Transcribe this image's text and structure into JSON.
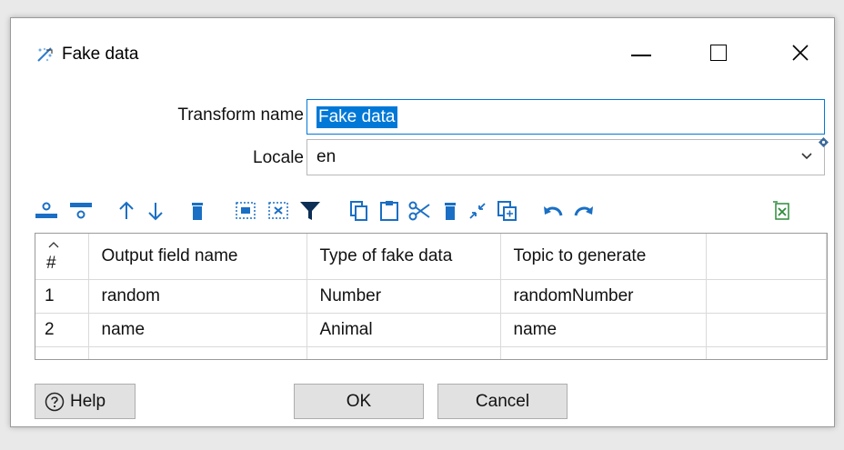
{
  "window": {
    "title": "Fake data",
    "icon": "fake-data-icon",
    "controls": [
      "minimize-icon",
      "maximize-icon",
      "close-icon"
    ]
  },
  "form": {
    "transform_name_label": "Transform name",
    "transform_name_value": "Fake data",
    "locale_label": "Locale",
    "locale_value": "en"
  },
  "toolbar": {
    "icons": [
      "insert-row-before-icon",
      "insert-row-after-icon",
      "move-up-icon",
      "move-down-icon",
      "delete-row-icon",
      "select-all-icon",
      "clear-selection-icon",
      "filter-icon",
      "copy-icon",
      "paste-icon",
      "cut-icon",
      "delete-icon",
      "keep-selected-icon",
      "duplicate-icon",
      "undo-icon",
      "redo-icon",
      "export-excel-icon"
    ]
  },
  "grid": {
    "columns": [
      "#",
      "Output field name",
      "Type of fake data",
      "Topic to generate"
    ],
    "rows": [
      [
        "1",
        "random",
        "Number",
        "randomNumber"
      ],
      [
        "2",
        "name",
        "Animal",
        "name"
      ]
    ]
  },
  "buttons": {
    "help": "Help",
    "ok": "OK",
    "cancel": "Cancel"
  },
  "colors": {
    "selection": "#0078d7",
    "toolbar_icon": "#1a6fc4",
    "button_bg": "#e1e1e1"
  }
}
